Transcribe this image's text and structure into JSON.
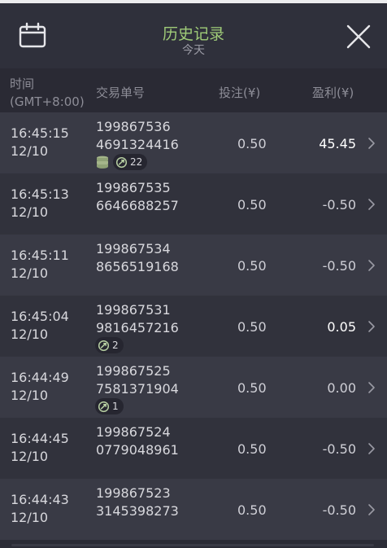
{
  "header": {
    "title": "历史记录",
    "subtitle": "今天",
    "calendar_icon": "calendar-icon",
    "close_icon": "close-icon"
  },
  "columns": {
    "time_line1": "时间",
    "time_line2": "(GMT+8:00)",
    "order": "交易单号",
    "bet": "投注(¥)",
    "profit": "盈利(¥)"
  },
  "rows": [
    {
      "time": "16:45:15",
      "date": "12/10",
      "order1": "199867536",
      "order2": "4691324416",
      "bet": "0.50",
      "profit": "45.45",
      "positive": true,
      "coins": true,
      "badge": "22"
    },
    {
      "time": "16:45:13",
      "date": "12/10",
      "order1": "199867535",
      "order2": "6646688257",
      "bet": "0.50",
      "profit": "-0.50",
      "positive": false,
      "coins": false,
      "badge": ""
    },
    {
      "time": "16:45:11",
      "date": "12/10",
      "order1": "199867534",
      "order2": "8656519168",
      "bet": "0.50",
      "profit": "-0.50",
      "positive": false,
      "coins": false,
      "badge": ""
    },
    {
      "time": "16:45:04",
      "date": "12/10",
      "order1": "199867531",
      "order2": "9816457216",
      "bet": "0.50",
      "profit": "0.05",
      "positive": true,
      "coins": false,
      "badge": "2"
    },
    {
      "time": "16:44:49",
      "date": "12/10",
      "order1": "199867525",
      "order2": "7581371904",
      "bet": "0.50",
      "profit": "0.00",
      "positive": false,
      "coins": false,
      "badge": "1"
    },
    {
      "time": "16:44:45",
      "date": "12/10",
      "order1": "199867524",
      "order2": "0779048961",
      "bet": "0.50",
      "profit": "-0.50",
      "positive": false,
      "coins": false,
      "badge": ""
    },
    {
      "time": "16:44:43",
      "date": "12/10",
      "order1": "199867523",
      "order2": "3145398273",
      "bet": "0.50",
      "profit": "-0.50",
      "positive": false,
      "coins": false,
      "badge": ""
    }
  ],
  "colors": {
    "title_green": "#9fcb78",
    "row_odd": "#393a45",
    "row_even": "#31323c",
    "header_bg": "#2f303b"
  }
}
